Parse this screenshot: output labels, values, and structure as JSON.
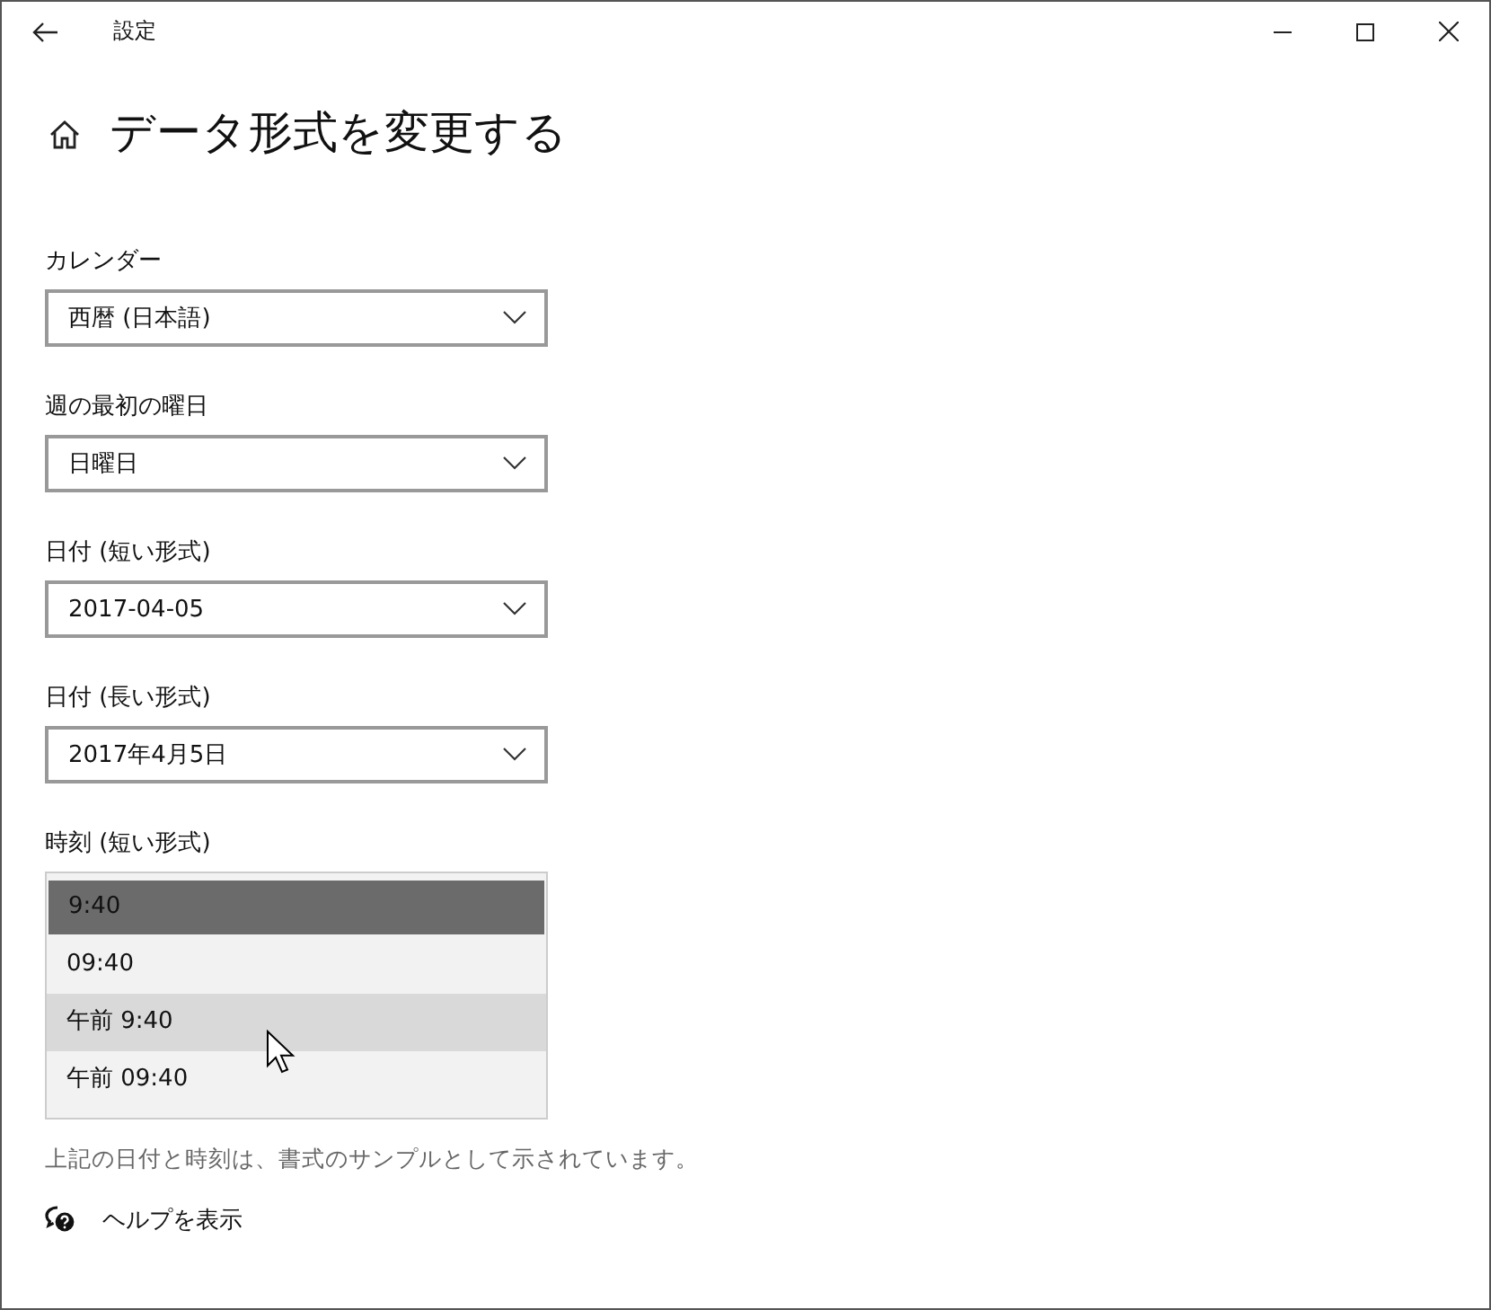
{
  "window": {
    "title": "設定"
  },
  "page": {
    "title": "データ形式を変更する"
  },
  "settings": [
    {
      "kind": "dropdown",
      "label": "カレンダー",
      "value": "西暦 (日本語)"
    },
    {
      "kind": "dropdown",
      "label": "週の最初の曜日",
      "value": "日曜日"
    },
    {
      "kind": "dropdown",
      "label": "日付 (短い形式)",
      "value": "2017-04-05"
    },
    {
      "kind": "dropdown",
      "label": "日付 (長い形式)",
      "value": "2017年4月5日"
    },
    {
      "kind": "open-list",
      "label": "時刻 (短い形式)",
      "options": [
        {
          "text": "9:40",
          "selected": true,
          "hovered": false
        },
        {
          "text": "09:40",
          "selected": false,
          "hovered": false
        },
        {
          "text": "午前 9:40",
          "selected": false,
          "hovered": true
        },
        {
          "text": "午前 09:40",
          "selected": false,
          "hovered": false
        }
      ]
    }
  ],
  "note": "上記の日付と時刻は、書式のサンプルとして示されています。",
  "help_link": "ヘルプを表示"
}
